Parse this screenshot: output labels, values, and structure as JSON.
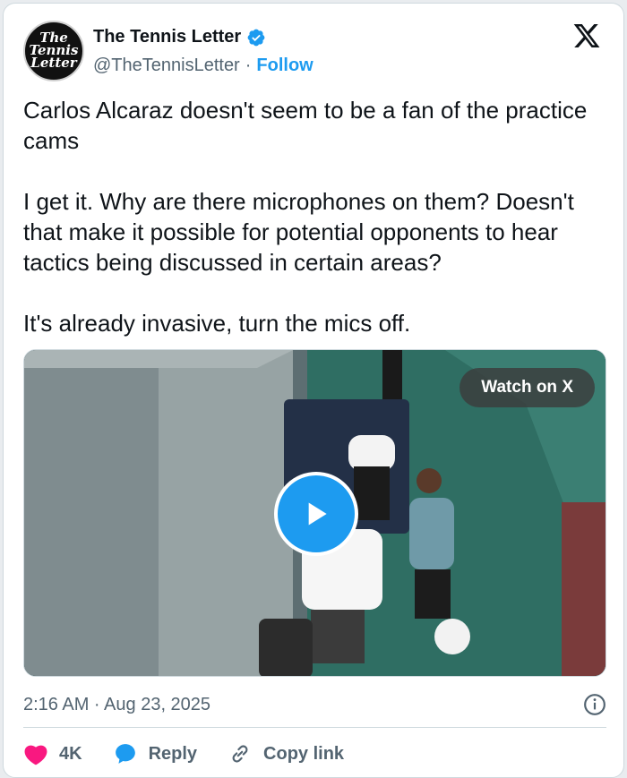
{
  "author": {
    "avatar_lines": [
      "The",
      "Tennis",
      "Letter"
    ],
    "display_name": "The Tennis Letter",
    "handle": "@TheTennisLetter",
    "separator": "·",
    "follow_label": "Follow"
  },
  "tweet": {
    "text": "Carlos Alcaraz doesn't seem to be a fan of the practice cams\n\nI get it. Why are there microphones on them? Doesn't that make it possible for potential opponents to hear tactics being discussed in certain areas?\n\nIt's already invasive, turn the mics off."
  },
  "media": {
    "watch_label": "Watch on X"
  },
  "meta": {
    "timestamp": "2:16 AM · Aug 23, 2025"
  },
  "actions": {
    "like_count": "4K",
    "reply_label": "Reply",
    "copy_link_label": "Copy link"
  },
  "colors": {
    "accent": "#1d9bf0",
    "like": "#f91880",
    "text": "#0f1419",
    "muted": "#536471"
  },
  "icons": [
    "verified-badge-icon",
    "x-logo-icon",
    "play-icon",
    "info-icon",
    "heart-icon",
    "reply-bubble-icon",
    "link-icon"
  ]
}
